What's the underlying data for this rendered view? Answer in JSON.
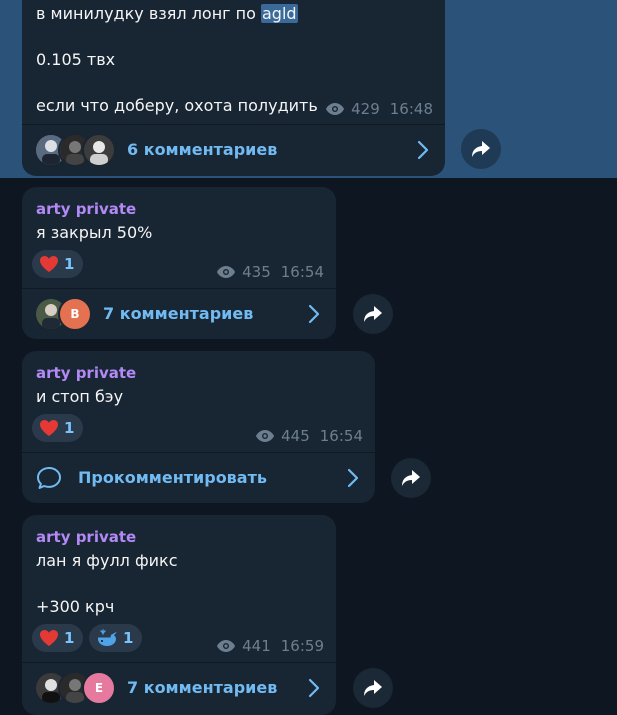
{
  "msg1": {
    "line1_prefix": "в минилудку взял лонг по ",
    "line1_highlight": "agld",
    "line2": "0.105 твх",
    "line3": "если что доберу, охота полудить",
    "views": "429",
    "time": "16:48",
    "comments_label": "6 комментариев"
  },
  "msg2": {
    "author": "arty private",
    "text": "я закрыл 50%",
    "reaction_emoji": "heart",
    "reaction_count": "1",
    "views": "435",
    "time": "16:54",
    "avatar_letter": "B",
    "comments_label": "7 комментариев"
  },
  "msg3": {
    "author": "arty private",
    "text": "и стоп бэу",
    "reaction_emoji": "heart",
    "reaction_count": "1",
    "views": "445",
    "time": "16:54",
    "comments_label": "Прокомментировать"
  },
  "msg4": {
    "author": "arty private",
    "line1": "лан я фулл фикс",
    "line2": "+300 крч",
    "reaction1_emoji": "heart",
    "reaction1_count": "1",
    "reaction2_emoji": "whale",
    "reaction2_count": "1",
    "views": "441",
    "time": "16:59",
    "avatar_letter": "E",
    "comments_label": "7 комментариев"
  },
  "colors": {
    "background": "#0e1621",
    "selected_band": "#2b5278",
    "bubble": "#182533",
    "author": "#b289f5",
    "link": "#71baf2",
    "meta": "#6d7f8f",
    "heart": "#e53935"
  }
}
